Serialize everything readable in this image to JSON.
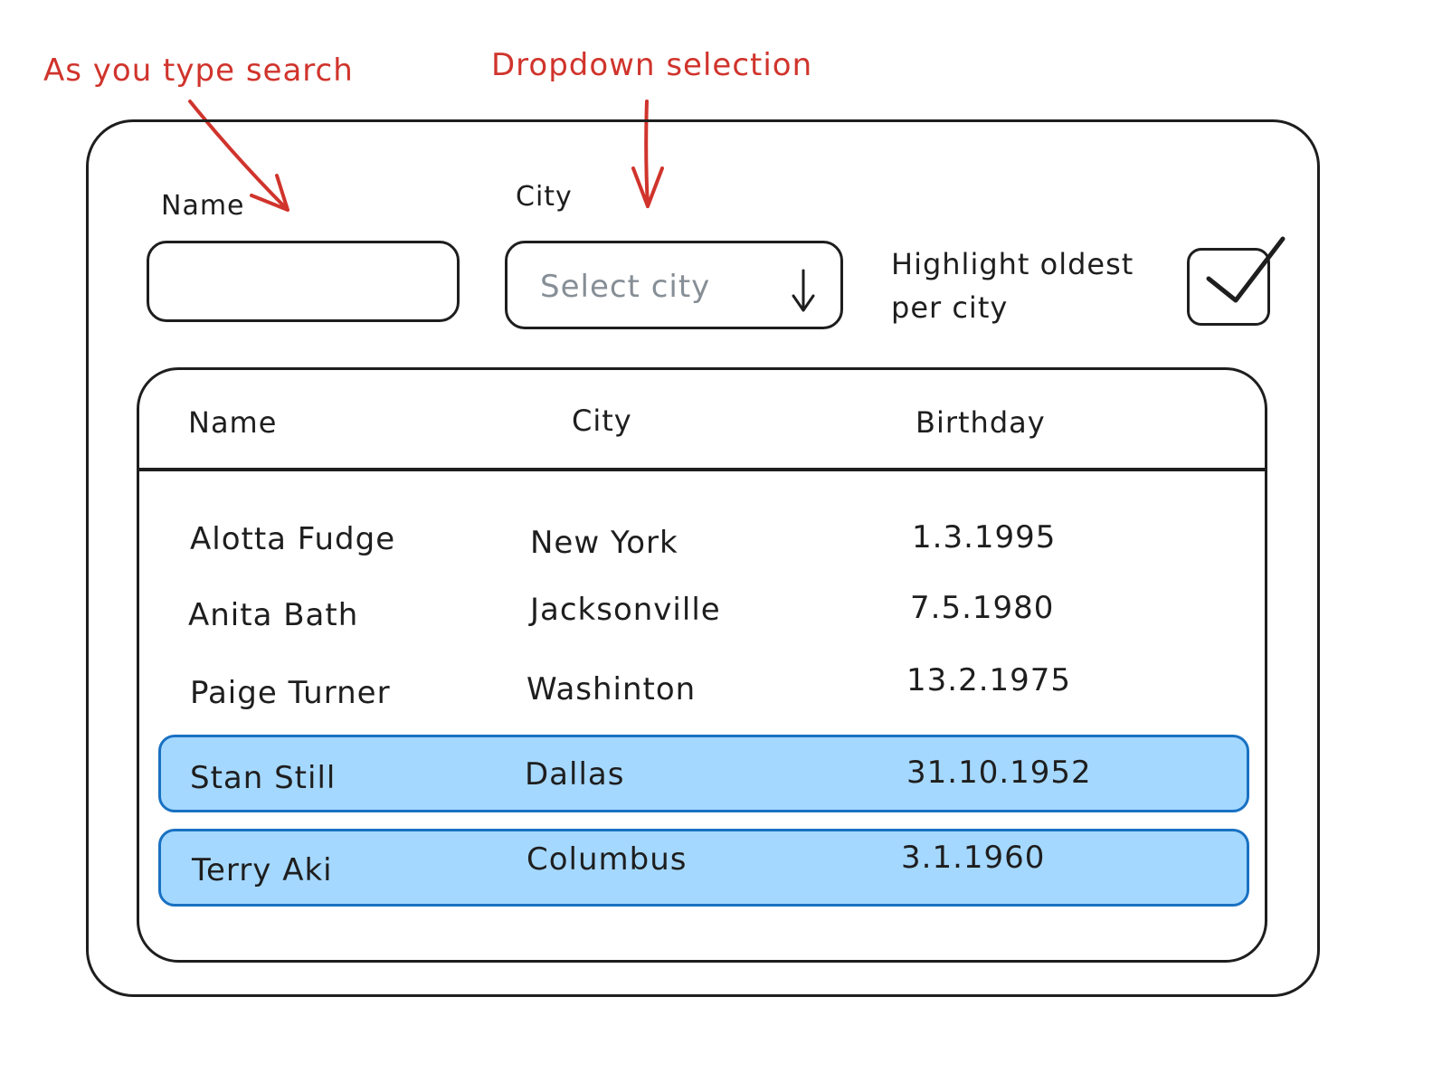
{
  "annotations": {
    "search_note": "As you type search",
    "dropdown_note": "Dropdown selection"
  },
  "filters": {
    "name_label": "Name",
    "name_value": "",
    "city_label": "City",
    "city_placeholder": "Select city",
    "highlight_label": "Highlight oldest per city",
    "highlight_checked": true
  },
  "table": {
    "columns": [
      "Name",
      "City",
      "Birthday"
    ],
    "rows": [
      {
        "name": "Alotta Fudge",
        "city": "New York",
        "birthday": "1.3.1995",
        "highlighted": false
      },
      {
        "name": "Anita Bath",
        "city": "Jacksonville",
        "birthday": "7.5.1980",
        "highlighted": false
      },
      {
        "name": "Paige Turner",
        "city": "Washinton",
        "birthday": "13.2.1975",
        "highlighted": false
      },
      {
        "name": "Stan Still",
        "city": "Dallas",
        "birthday": "31.10.1952",
        "highlighted": true
      },
      {
        "name": "Terry Aki",
        "city": "Columbus",
        "birthday": "3.1.1960",
        "highlighted": true
      }
    ]
  },
  "colors": {
    "annotation": "#d0342c",
    "stroke": "#1e1e1e",
    "highlight_fill": "#a5d8ff",
    "highlight_border": "#1971c2",
    "placeholder": "#868e96"
  }
}
